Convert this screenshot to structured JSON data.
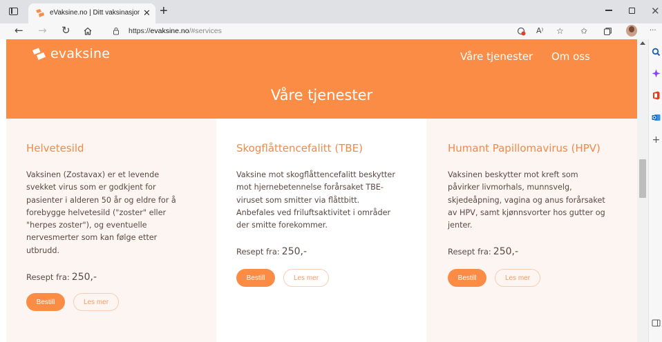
{
  "browser": {
    "tab_title": "eVaksine.no | Ditt vaksinasjonsse",
    "tab_close": "✕",
    "new_tab": "+",
    "url_scheme": "https://",
    "url_host": "evaksine.no",
    "url_path": "/#services",
    "read_aloud": "A⁾",
    "more_menu": "···",
    "colors": {
      "tabbar": "#dfe1e5",
      "toolbar": "#f7f7f7"
    }
  },
  "site": {
    "logo_text": "evaksine",
    "nav": [
      "Våre tjenester",
      "Om oss"
    ],
    "hero_title": "Våre tjenester",
    "colors": {
      "brand": "#fb8c45",
      "title": "#f08a49",
      "text": "#5a4842"
    }
  },
  "services": [
    {
      "title": "Helvetesild",
      "description_lines": [
        "Vaksinen (Zostavax) er et levende",
        "svekket virus som er godkjent for",
        "pasienter i alderen 50 år og eldre for å",
        "forebygge helvetesild (\"zoster\" eller",
        "\"herpes zoster\"), og eventuelle",
        "nervesmerter som kan følge etter",
        "utbrudd."
      ],
      "price_label": "Resept fra:",
      "price_value": "250,-",
      "order_label": "Bestill",
      "more_label": "Les mer"
    },
    {
      "title": "Skogflåttencefalitt (TBE)",
      "description_lines": [
        "Vaksine mot skogflåttencefalitt beskytter",
        "mot hjernebetennelse forårsaket TBE-",
        "viruset som smitter via flåttbitt.",
        "Anbefales ved friluftsaktivitet i områder",
        "der smitte forekommer."
      ],
      "price_label": "Resept fra:",
      "price_value": "250,-",
      "order_label": "Bestill",
      "more_label": "Les mer"
    },
    {
      "title": "Humant Papillomavirus (HPV)",
      "description_lines": [
        "Vaksinen beskytter mot kreft som",
        "påvirker livmorhals, munnsvelg,",
        "skjedeåpning, vagina og anus forårsaket",
        "av HPV, samt kjønnsvorter hos gutter og",
        "jenter."
      ],
      "price_label": "Resept fra:",
      "price_value": "250,-",
      "order_label": "Bestill",
      "more_label": "Les mer"
    }
  ]
}
